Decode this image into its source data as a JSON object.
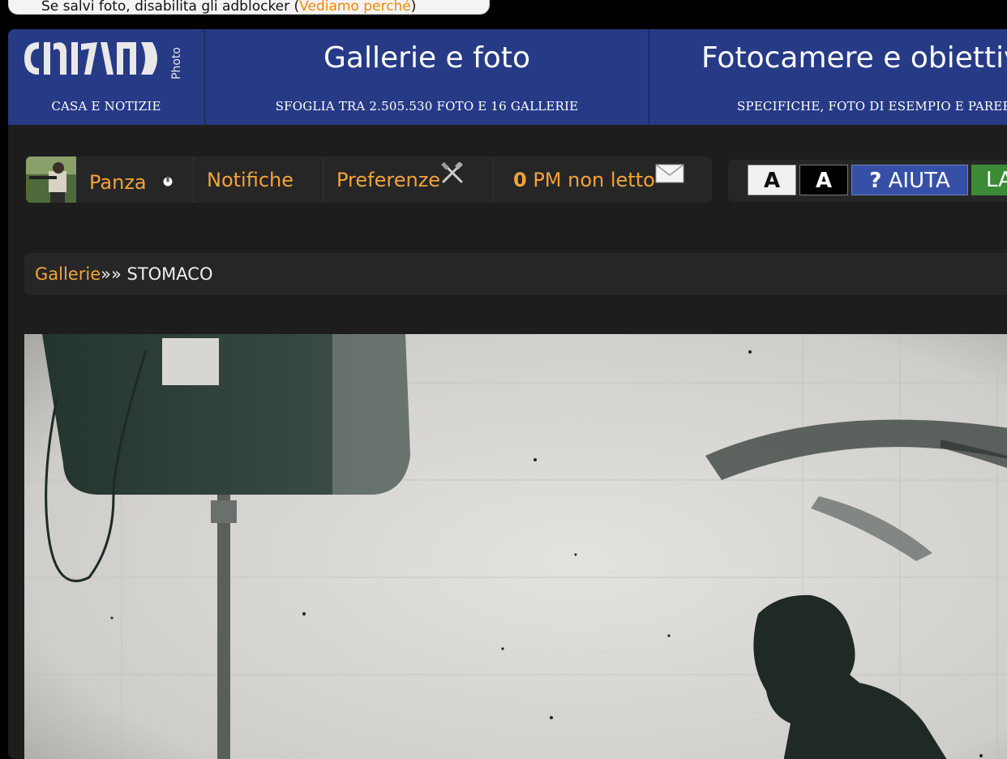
{
  "notice": {
    "text": "Se salvi foto, disabilita gli adblocker (",
    "link": "Vediamo perché",
    "tail": ")"
  },
  "nav": {
    "logo_text": "Photo",
    "items": [
      {
        "title": "",
        "subtitle": "CASA E NOTIZIE"
      },
      {
        "title": "Gallerie e foto",
        "subtitle": "SFOGLIA TRA 2.505.530 FOTO E 16 GALLERIE"
      },
      {
        "title": "Fotocamere e obiettivi",
        "subtitle": "SPECIFICHE, FOTO DI ESEMPIO E PARERI"
      }
    ]
  },
  "userbar": {
    "username": "Panza",
    "notifications": "Notifiche",
    "preferences": "Preferenze",
    "pm_count": "0",
    "pm_label": " PM non letto"
  },
  "themebar": {
    "light": "A",
    "dark": "A",
    "help_q": "?",
    "help": " AIUTA",
    "lang": "LA"
  },
  "breadcrumb": {
    "link": "Gallerie",
    "separator": "»» ",
    "current": "STOMACO"
  },
  "colors": {
    "nav_bg": "#263a86",
    "accent": "#f3a33a",
    "panel_bg": "#1d1d1d"
  }
}
